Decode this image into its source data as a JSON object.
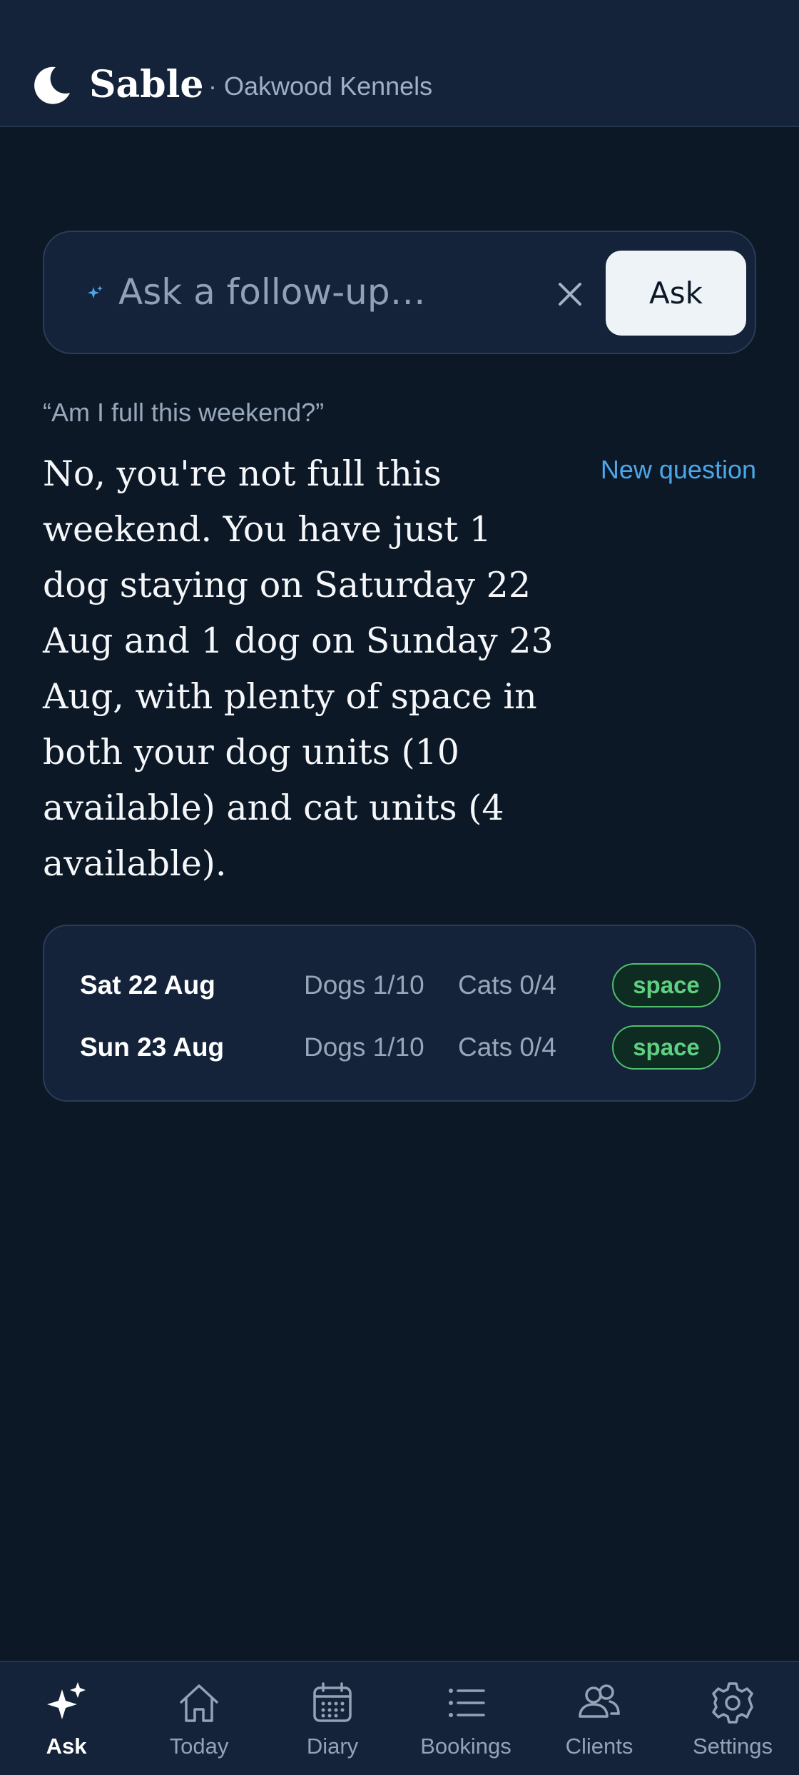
{
  "header": {
    "app_name": "Sable",
    "subtitle": "· Oakwood Kennels",
    "logo_icon": "moon-icon"
  },
  "ask": {
    "placeholder": "Ask a follow-up…",
    "button_label": "Ask",
    "clear_icon": "close-icon"
  },
  "conversation": {
    "question": "“Am I full this weekend?”",
    "new_question_label": "New question",
    "answer": "No, you're not full this weekend. You have just 1 dog staying on Saturday 22 Aug and 1 dog on Sunday 23 Aug, with plenty of space in both your dog units (10 available) and cat units (4 available)."
  },
  "summary": {
    "rows": [
      {
        "date": "Sat 22 Aug",
        "dogs": "Dogs 1/10",
        "cats": "Cats 0/4",
        "status": "space"
      },
      {
        "date": "Sun 23 Aug",
        "dogs": "Dogs 1/10",
        "cats": "Cats 0/4",
        "status": "space"
      }
    ]
  },
  "nav": {
    "active": "Ask",
    "items": [
      {
        "label": "Ask",
        "icon": "sparkles-icon"
      },
      {
        "label": "Today",
        "icon": "home-icon"
      },
      {
        "label": "Diary",
        "icon": "calendar-icon"
      },
      {
        "label": "Bookings",
        "icon": "list-icon"
      },
      {
        "label": "Clients",
        "icon": "users-icon"
      },
      {
        "label": "Settings",
        "icon": "gear-icon"
      }
    ]
  },
  "colors": {
    "background": "#0c1826",
    "surface": "#14233a",
    "accent_link": "#4aa8ea",
    "status_ok": "#5fd081"
  }
}
